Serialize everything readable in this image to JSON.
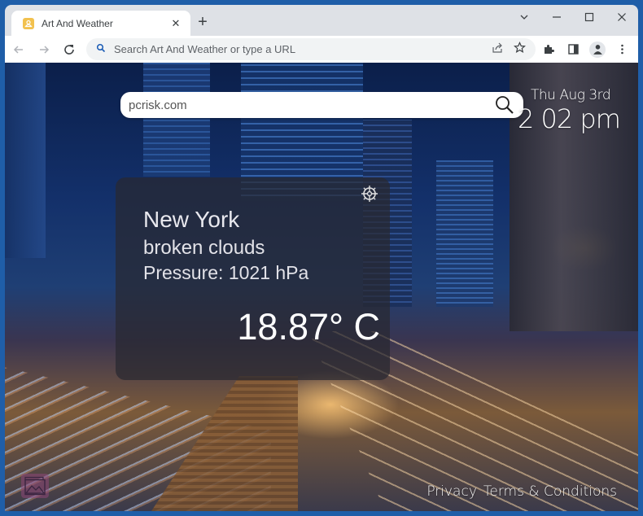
{
  "browser": {
    "tab": {
      "title": "Art And Weather",
      "favicon": "art-and-weather-icon"
    },
    "new_tab_label": "+",
    "window_controls": [
      "tab-search",
      "minimize",
      "maximize",
      "close"
    ],
    "address_bar": {
      "placeholder": "Search Art And Weather or type a URL",
      "value": ""
    }
  },
  "page": {
    "search": {
      "value": "pcrisk.com",
      "placeholder": ""
    },
    "clock": {
      "date": "Thu Aug 3rd",
      "time": "2 02 pm"
    },
    "weather": {
      "city": "New York",
      "description": "broken clouds",
      "pressure_label": "Pressure:",
      "pressure_value": "1021 hPa",
      "temperature": "18.87° C"
    },
    "footer": {
      "privacy": "Privacy",
      "terms": "Terms & Conditions"
    }
  },
  "colors": {
    "frame": "#1f5ea8",
    "tab_strip": "#dee1e6",
    "favicon": "#f2c14e",
    "weather_panel": "#282830"
  }
}
